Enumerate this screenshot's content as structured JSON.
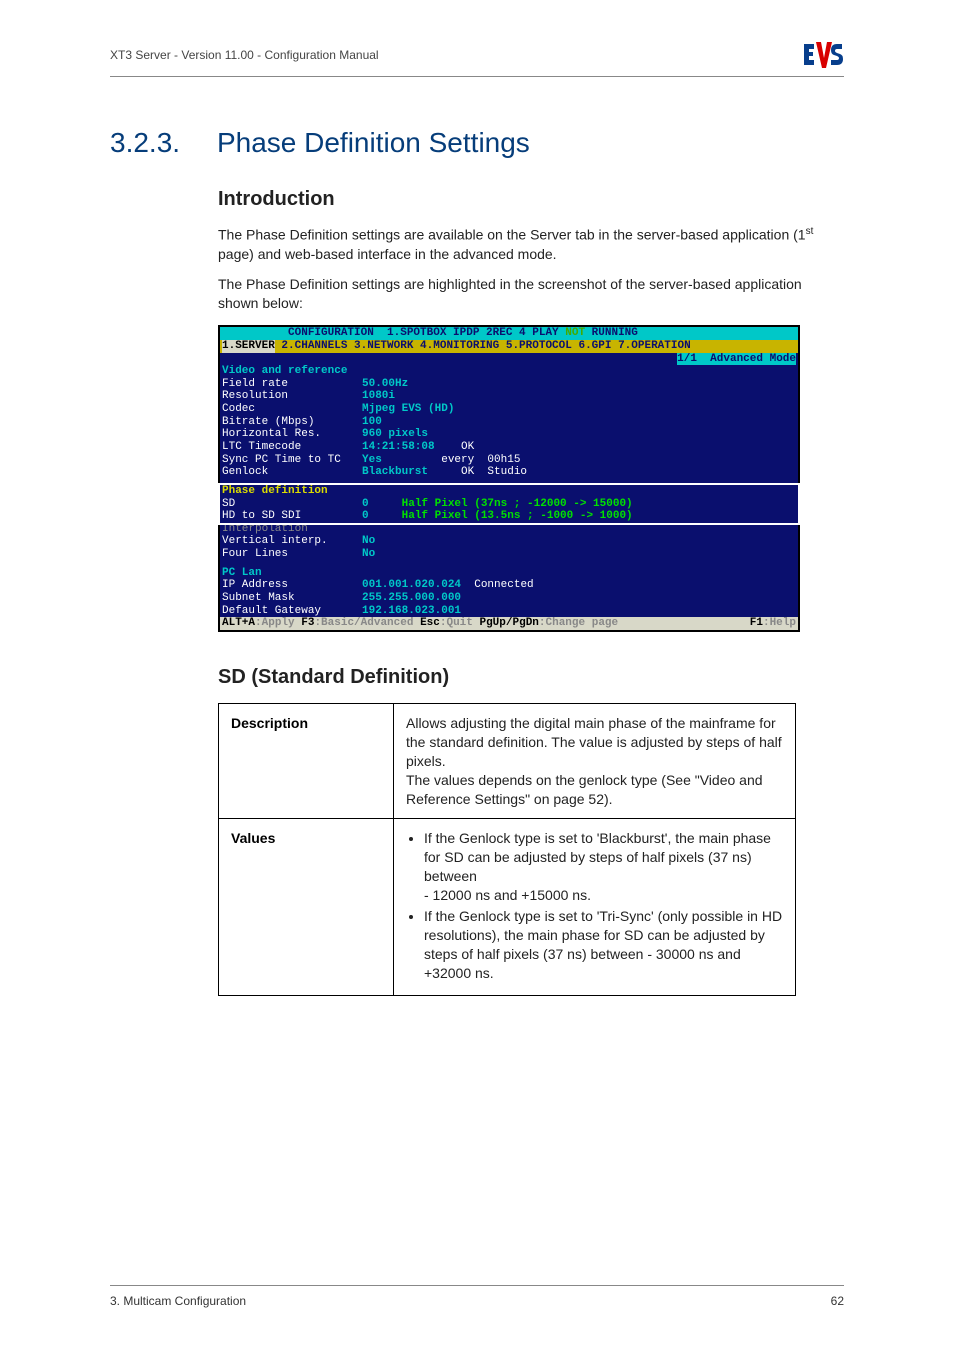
{
  "header": {
    "left": "XT3 Server - Version 11.00 - Configuration Manual"
  },
  "section": {
    "number": "3.2.3.",
    "title": "Phase Definition Settings"
  },
  "intro": {
    "heading": "Introduction",
    "para1_prefix": "The Phase Definition settings are available on the Server tab in the server-based application (1",
    "para1_sup": "st",
    "para1_suffix": " page) and web-based interface in the advanced mode.",
    "para2": "The Phase Definition settings are highlighted in the screenshot of the server-based application shown below:"
  },
  "terminal": {
    "top_bar_prefix": "          CONFIGURATION  ",
    "top_bar_mid": "1.SPOTBOX IPDP 2REC 4 PLAY ",
    "top_bar_not": "NOT ",
    "top_bar_running": "RUNNING  ",
    "tabs_left": "1.SERVER",
    "tabs_rest": " 2.CHANNELS 3.NETWORK 4.MONITORING 5.PROTOCOL 6.GPI 7.OPERATION",
    "mode": "1/1  Advanced Mode",
    "video_heading": "Video and reference",
    "field_rate_lbl": "Field rate",
    "field_rate_val": "50.00Hz",
    "resolution_lbl": "Resolution",
    "resolution_val": "1080i",
    "codec_lbl": "Codec",
    "codec_val": "Mjpeg EVS (HD)",
    "bitrate_lbl": "Bitrate (Mbps)",
    "bitrate_val": "100",
    "hres_lbl": "Horizontal Res.",
    "hres_val": "960 pixels",
    "ltc_lbl": "LTC Timecode",
    "ltc_val": "14:21:58:08",
    "ltc_ok": "    OK",
    "sync_lbl": "Sync PC Time to TC",
    "sync_val": "Yes",
    "sync_extra": "         every  00h15",
    "genlock_lbl": "Genlock",
    "genlock_val": "Blackburst",
    "genlock_extra": "     OK  Studio",
    "phase_heading": "Phase definition",
    "sd_lbl": "SD",
    "sd_val": "0",
    "sd_note": "     Half Pixel (37ns ; -12000 -> 15000)",
    "hd_lbl": "HD to SD SDI",
    "hd_val": "0",
    "hd_note": "     Half Pixel (13.5ns ; -1000 -> 1000)",
    "interp_heading": "Interpolation",
    "vint_lbl": "Vertical interp.",
    "vint_val": "No",
    "four_lbl": "Four Lines",
    "four_val": "No",
    "pclan_heading": "PC Lan",
    "ip_lbl": "IP Address",
    "ip_val": "001.001.020.024",
    "ip_status": "  Connected",
    "sub_lbl": "Subnet Mask",
    "sub_val": "255.255.000.000",
    "gw_lbl": "Default Gateway",
    "gw_val": "192.168.023.001",
    "bottom_alt": "ALT+A",
    "bottom_apply": ":Apply ",
    "bottom_f3": "F3",
    "bottom_mode": ":Basic/Advanced ",
    "bottom_esc": "Esc",
    "bottom_quit": ":Quit ",
    "bottom_pg": "PgUp/PgDn",
    "bottom_change": ":Change page",
    "bottom_f1": "F1",
    "bottom_help": ":Help"
  },
  "sd_section": {
    "heading": "SD (Standard Definition)",
    "desc_label": "Description",
    "desc_text": "Allows adjusting the digital main phase of the mainframe for the standard definition. The value is adjusted by steps of half pixels.\nThe values depends on the genlock type (See \"Video and Reference Settings\" on page 52).",
    "values_label": "Values",
    "values_items": [
      "If the Genlock type is set to 'Blackburst', the main phase for SD can be adjusted by steps of half pixels (37 ns) between\n- 12000 ns and +15000 ns.",
      "If the Genlock type is set to 'Tri-Sync' (only possible in HD resolutions), the main phase for SD can be adjusted by steps of half pixels (37 ns) between - 30000 ns and +32000 ns."
    ]
  },
  "footer": {
    "left": "3. Multicam Configuration",
    "right": "62"
  }
}
